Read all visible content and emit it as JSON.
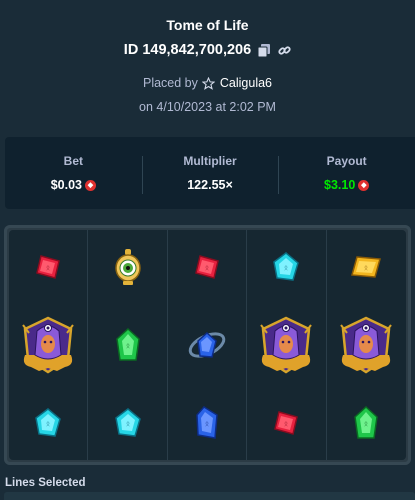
{
  "header": {
    "game_title": "Tome of Life",
    "bet_id": "ID 149,842,700,206",
    "placed_by_prefix": "Placed by",
    "username": "Caligula6",
    "placed_on": "on 4/10/2023 at 2:02 PM"
  },
  "stats": {
    "bet_label": "Bet",
    "bet_value": "$0.03",
    "multiplier_label": "Multiplier",
    "multiplier_value": "122.55×",
    "payout_label": "Payout",
    "payout_value": "$3.10"
  },
  "board": {
    "columns": [
      [
        "red-gem",
        "pharaoh-wild",
        "cyan-gem"
      ],
      [
        "scarab-eye",
        "green-gem",
        "cyan-gem"
      ],
      [
        "red-gem",
        "blue-orb",
        "blue-gem"
      ],
      [
        "cyan-gem",
        "pharaoh-wild",
        "red-gem"
      ],
      [
        "yellow-gem",
        "pharaoh-wild",
        "green-gem"
      ]
    ]
  },
  "footer": {
    "lines_selected_label": "Lines Selected"
  },
  "colors": {
    "background": "#1a2c38",
    "panel": "#0f212e",
    "payout_green": "#00e701",
    "muted_text": "#b1bad3"
  }
}
